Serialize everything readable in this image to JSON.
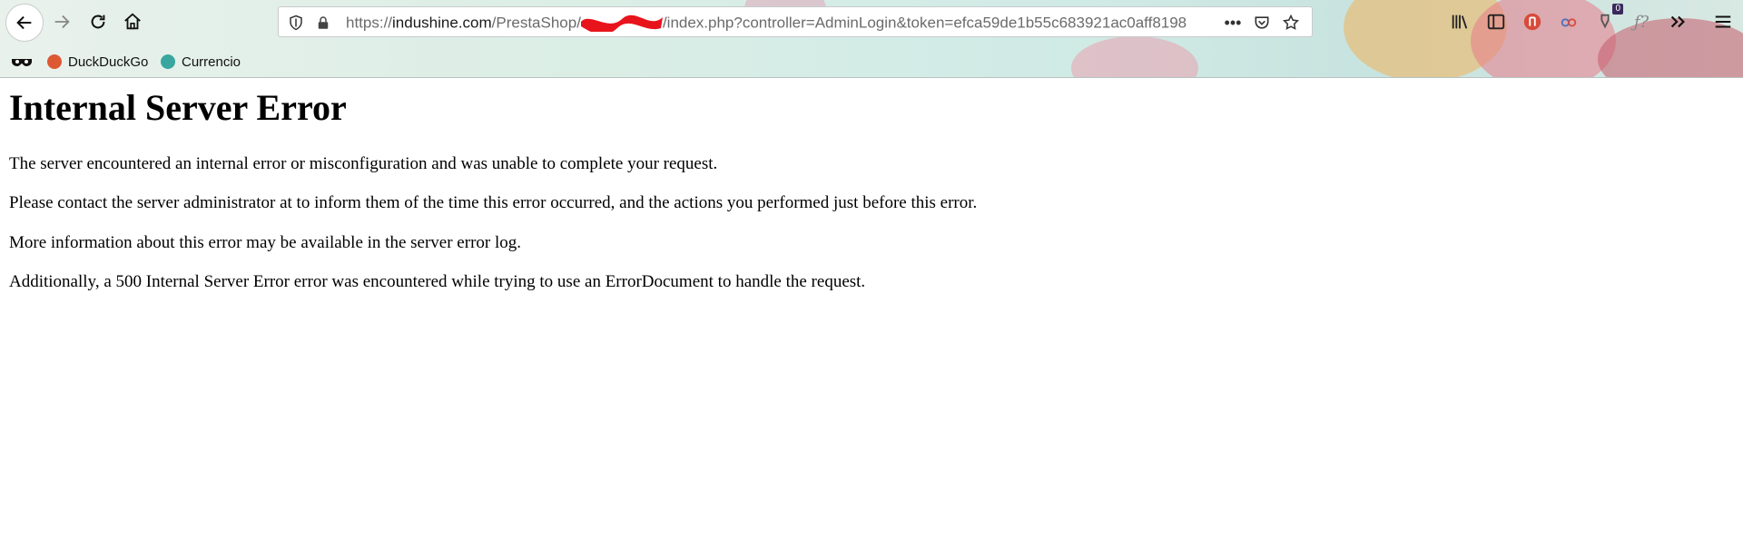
{
  "browser": {
    "url_scheme": "https://",
    "url_host": "indushine.com",
    "url_path_before": "/PrestaShop/",
    "url_path_after": "/index.php?controller=AdminLogin&token=efca59de1b55c683921ac0aff8198",
    "bookmarks": [
      {
        "label": "DuckDuckGo",
        "icon": "duckduckgo-icon",
        "color": "#de5833"
      },
      {
        "label": "Currencio",
        "icon": "currencio-icon",
        "color": "#3aa6a0"
      }
    ],
    "badge_count": "0"
  },
  "page": {
    "title": "Internal Server Error",
    "paragraphs": [
      "The server encountered an internal error or misconfiguration and was unable to complete your request.",
      "Please contact the server administrator at to inform them of the time this error occurred, and the actions you performed just before this error.",
      "More information about this error may be available in the server error log.",
      "Additionally, a 500 Internal Server Error error was encountered while trying to use an ErrorDocument to handle the request."
    ]
  }
}
